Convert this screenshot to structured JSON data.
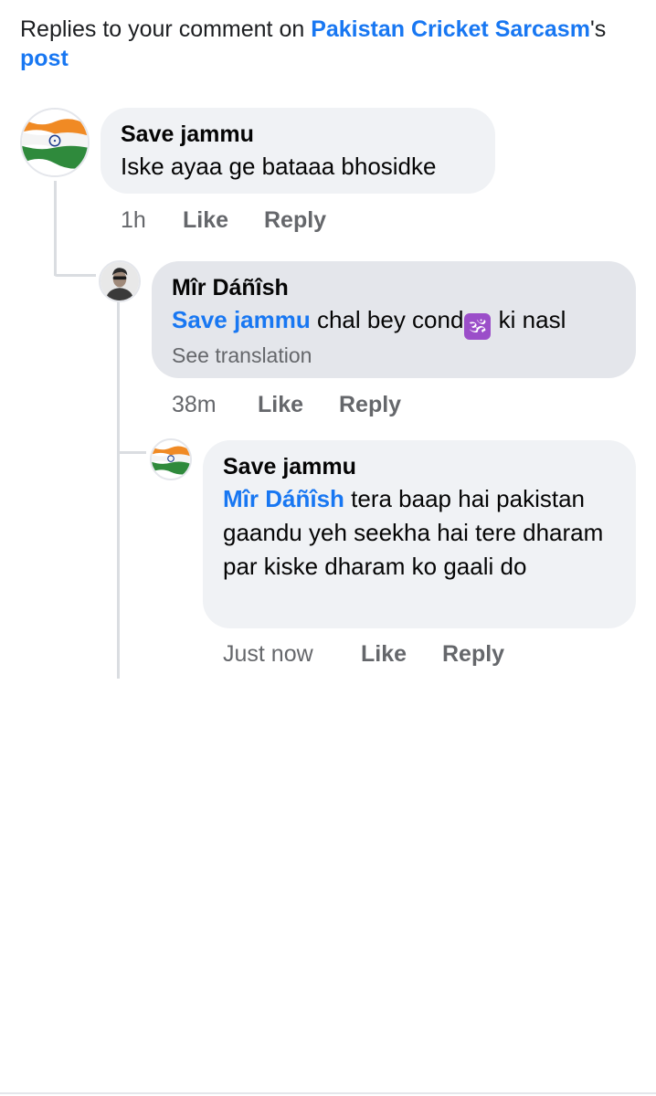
{
  "header": {
    "prefix": "Replies to your comment on ",
    "page_link": "Pakistan Cricket Sarcasm",
    "suffix": "'s",
    "post_link": "post"
  },
  "comments": [
    {
      "author": "Save jammu",
      "text": "Iske ayaa ge bataaa bhosidke",
      "time": "1h",
      "like_label": "Like",
      "reply_label": "Reply",
      "avatar": "india-flag-avatar"
    },
    {
      "author": "Mîr Dáñîsh",
      "mention": "Save jammu",
      "text_before_emoji": " chal bey cond",
      "emoji": "🕉",
      "emoji_name": "om-emoji",
      "text_after_emoji": " ki nasl",
      "see_translation": "See translation",
      "time": "38m",
      "like_label": "Like",
      "reply_label": "Reply",
      "avatar": "person-photo-avatar"
    },
    {
      "author": "Save jammu",
      "mention": "Mîr Dáñîsh",
      "text": " tera baap hai pakistan gaandu yeh seekha hai tere dharam par kiske dharam ko gaali do",
      "time": "Just now",
      "like_label": "Like",
      "reply_label": "Reply",
      "avatar": "india-flag-avatar"
    }
  ],
  "colors": {
    "link": "#1877f2",
    "bubble": "#f0f2f5",
    "bubble_highlight": "#e4e6eb",
    "meta": "#65676b",
    "emoji_bg": "#9b4ec9"
  }
}
